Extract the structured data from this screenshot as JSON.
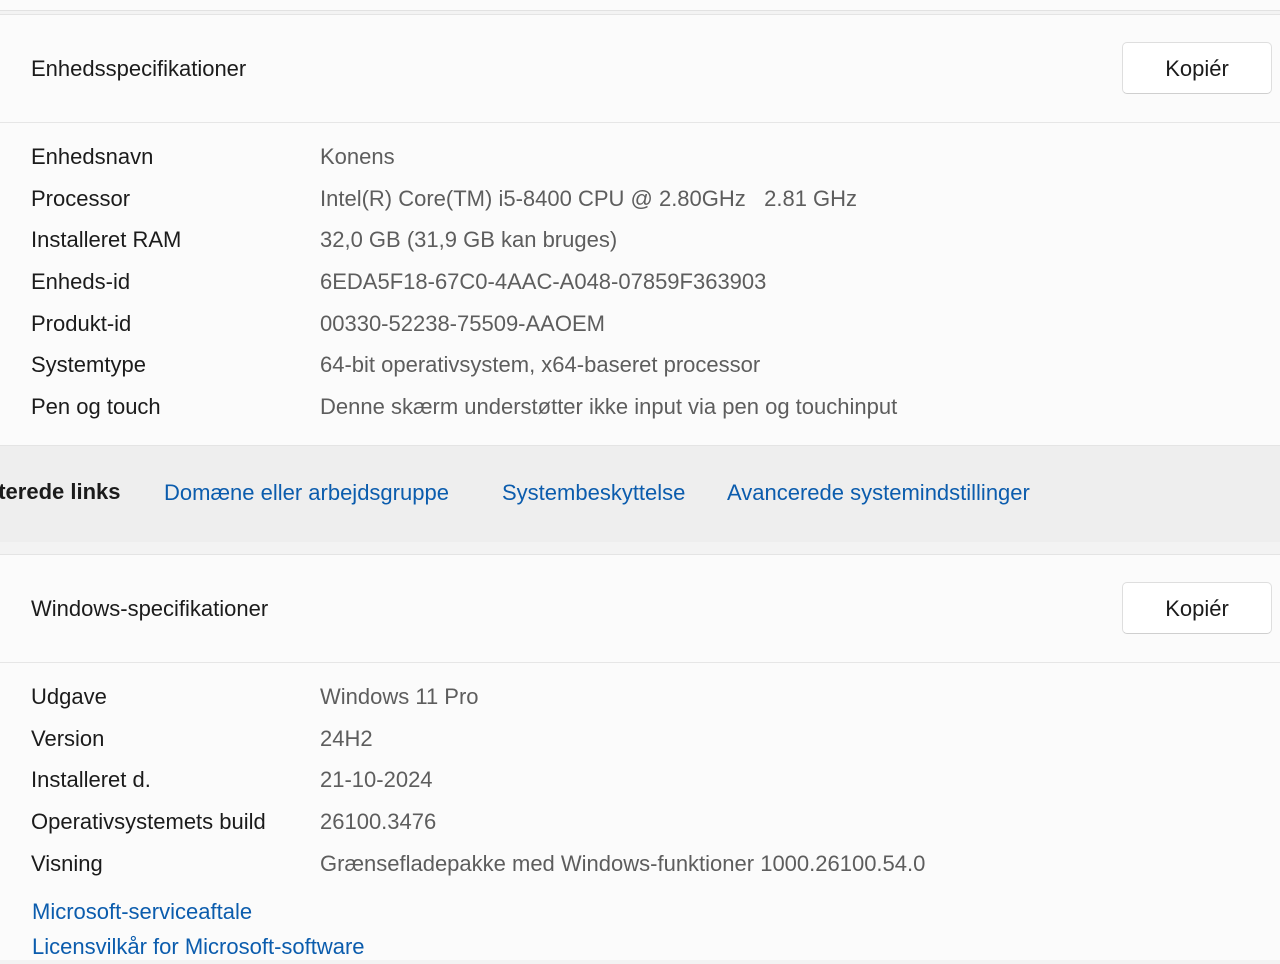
{
  "device_specs": {
    "title": "Enhedsspecifikationer",
    "copy_label": "Kopiér",
    "rows": [
      {
        "label": "Enhedsnavn",
        "value": "Konens"
      },
      {
        "label": "Processor",
        "value": "Intel(R) Core(TM) i5-8400 CPU @ 2.80GHz   2.81 GHz"
      },
      {
        "label": "Installeret RAM",
        "value": "32,0 GB (31,9 GB kan bruges)"
      },
      {
        "label": "Enheds-id",
        "value": "6EDA5F18-67C0-4AAC-A048-07859F363903"
      },
      {
        "label": "Produkt-id",
        "value": "00330-52238-75509-AAOEM"
      },
      {
        "label": "Systemtype",
        "value": "64-bit operativsystem, x64-baseret processor"
      },
      {
        "label": "Pen og touch",
        "value": "Denne skærm understøtter ikke input via pen og touchinput"
      }
    ]
  },
  "related_links": {
    "title": "aterede links",
    "links": [
      "Domæne eller arbejdsgruppe",
      "Systembeskyttelse",
      "Avancerede systemindstillinger"
    ]
  },
  "windows_specs": {
    "title": "Windows-specifikationer",
    "copy_label": "Kopiér",
    "rows": [
      {
        "label": "Udgave",
        "value": "Windows 11 Pro"
      },
      {
        "label": "Version",
        "value": "24H2"
      },
      {
        "label": "Installeret d.",
        "value": "21-10-2024"
      },
      {
        "label": "Operativsystemets build",
        "value": "26100.3476"
      },
      {
        "label": "Visning",
        "value": "Grænsefladepakke med Windows-funktioner 1000.26100.54.0"
      }
    ],
    "links": [
      "Microsoft-serviceaftale",
      "Licensvilkår for Microsoft-software"
    ]
  },
  "colors": {
    "link": "#0b5cad",
    "value_text": "#5d5d5d",
    "card_background": "#fbfbfb",
    "page_background": "#f3f3f3"
  }
}
